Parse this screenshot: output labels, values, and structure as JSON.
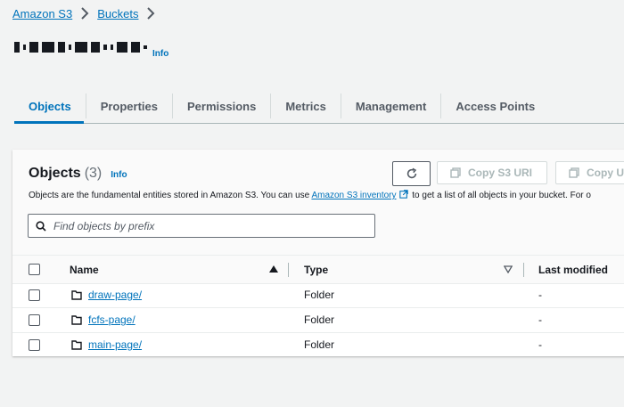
{
  "breadcrumb": {
    "items": [
      "Amazon S3",
      "Buckets"
    ]
  },
  "bucket": {
    "info_label": "Info"
  },
  "tabs": [
    "Objects",
    "Properties",
    "Permissions",
    "Metrics",
    "Management",
    "Access Points"
  ],
  "objects_panel": {
    "title": "Objects",
    "count": "(3)",
    "info_label": "Info",
    "description_before": "Objects are the fundamental entities stored in Amazon S3. You can use ",
    "inventory_link": "Amazon S3 inventory",
    "description_after": " to get a list of all objects in your bucket. For o",
    "copy_s3_uri_label": "Copy S3 URI",
    "copy_url_label": "Copy U"
  },
  "search": {
    "placeholder": "Find objects by prefix"
  },
  "table": {
    "columns": [
      "Name",
      "Type",
      "Last modified"
    ],
    "rows": [
      {
        "name": "draw-page/",
        "type": "Folder",
        "last_modified": "-"
      },
      {
        "name": "fcfs-page/",
        "type": "Folder",
        "last_modified": "-"
      },
      {
        "name": "main-page/",
        "type": "Folder",
        "last_modified": "-"
      }
    ]
  },
  "colors": {
    "link": "#0073bb",
    "text": "#16191f",
    "background": "#f2f3f3",
    "disabled": "#aab7b8"
  }
}
